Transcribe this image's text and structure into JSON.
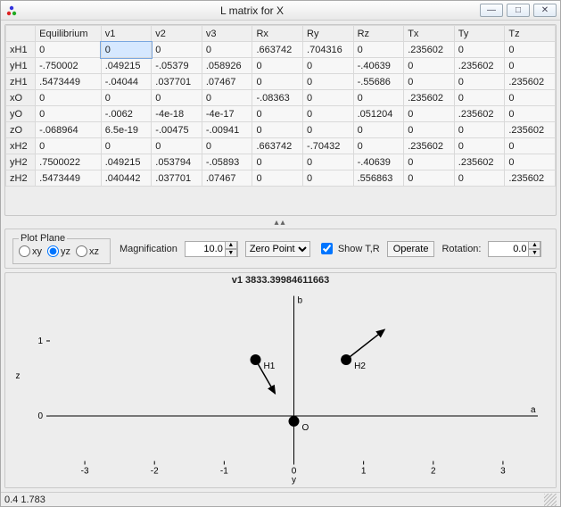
{
  "window": {
    "title": "L matrix for X",
    "min_glyph": "—",
    "max_glyph": "□",
    "close_glyph": "✕"
  },
  "table": {
    "headers": [
      "",
      "Equilibrium",
      "v1",
      "v2",
      "v3",
      "Rx",
      "Ry",
      "Rz",
      "Tx",
      "Ty",
      "Tz"
    ],
    "rows": [
      [
        "xH1",
        "0",
        "0",
        "0",
        "0",
        ".663742",
        ".704316",
        "0",
        ".235602",
        "0",
        "0"
      ],
      [
        "yH1",
        "-.750002",
        ".049215",
        "-.05379",
        ".058926",
        "0",
        "0",
        "-.40639",
        "0",
        ".235602",
        "0"
      ],
      [
        "zH1",
        ".5473449",
        "-.04044",
        ".037701",
        ".07467",
        "0",
        "0",
        "-.55686",
        "0",
        "0",
        ".235602"
      ],
      [
        "xO",
        "0",
        "0",
        "0",
        "0",
        "-.08363",
        "0",
        "0",
        ".235602",
        "0",
        "0"
      ],
      [
        "yO",
        "0",
        "-.0062",
        "-4e-18",
        "-4e-17",
        "0",
        "0",
        ".051204",
        "0",
        ".235602",
        "0"
      ],
      [
        "zO",
        "-.068964",
        "6.5e-19",
        "-.00475",
        "-.00941",
        "0",
        "0",
        "0",
        "0",
        "0",
        ".235602"
      ],
      [
        "xH2",
        "0",
        "0",
        "0",
        "0",
        ".663742",
        "-.70432",
        "0",
        ".235602",
        "0",
        "0"
      ],
      [
        "yH2",
        ".7500022",
        ".049215",
        ".053794",
        "-.05893",
        "0",
        "0",
        "-.40639",
        "0",
        ".235602",
        "0"
      ],
      [
        "zH2",
        ".5473449",
        ".040442",
        ".037701",
        ".07467",
        "0",
        "0",
        ".556863",
        "0",
        "0",
        ".235602"
      ]
    ],
    "selected": {
      "row": 0,
      "col": 2
    }
  },
  "toolbar": {
    "plane_legend": "Plot Plane",
    "planes": [
      "xy",
      "yz",
      "xz"
    ],
    "plane_selected": "yz",
    "mag_label": "Magnification",
    "mag_value": "10.0",
    "zero_options": [
      "Zero Point"
    ],
    "zero_selected": "Zero Point",
    "show_tr_label": "Show T,R",
    "show_tr_checked": true,
    "operate_label": "Operate",
    "rot_label": "Rotation:",
    "rot_value": "0.0"
  },
  "plot": {
    "title": "v1 3833.39984611663",
    "xlabel": "y",
    "ylabel": "z",
    "a_label": "a",
    "b_label": "b",
    "points": [
      {
        "name": "H1",
        "label": "H1",
        "y": -0.55,
        "z": 0.75,
        "dx": 0.28,
        "dy": -0.45
      },
      {
        "name": "O",
        "label": "O",
        "y": 0.0,
        "z": -0.07,
        "dx": 0,
        "dy": 0
      },
      {
        "name": "H2",
        "label": "H2",
        "y": 0.75,
        "z": 0.75,
        "dx": 0.55,
        "dy": 0.4
      }
    ],
    "xrange": [
      -3.5,
      3.5
    ],
    "yrange": [
      -0.6,
      1.6
    ],
    "xticks": [
      -3,
      -2,
      -1,
      0,
      1,
      2,
      3
    ],
    "yticks": [
      0,
      1
    ]
  },
  "status": {
    "coords": "0.4  1.783"
  },
  "chart_data": {
    "type": "scatter",
    "title": "v1 3833.39984611663",
    "xlabel": "y",
    "ylabel": "z",
    "xlim": [
      -3.5,
      3.5
    ],
    "ylim": [
      -0.6,
      1.6
    ],
    "series": [
      {
        "name": "H1",
        "x": [
          -0.55
        ],
        "y": [
          0.75
        ],
        "vector": [
          0.28,
          -0.45
        ]
      },
      {
        "name": "O",
        "x": [
          0.0
        ],
        "y": [
          -0.07
        ],
        "vector": [
          0,
          0
        ]
      },
      {
        "name": "H2",
        "x": [
          0.75
        ],
        "y": [
          0.75
        ],
        "vector": [
          0.55,
          0.4
        ]
      }
    ]
  }
}
